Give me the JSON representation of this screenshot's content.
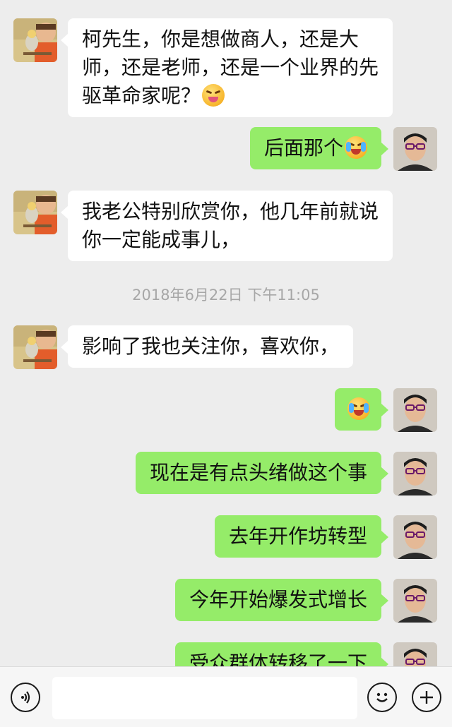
{
  "messages": [
    {
      "side": "in",
      "lines": [
        "柯先生，你是想做商人，还是大",
        "师，还是老师，还是一个业界的先",
        "驱革命家呢？"
      ],
      "emoji": "tongue-face"
    },
    {
      "side": "out",
      "lines": [
        "后面那个"
      ],
      "emoji": "laughing-tears-face"
    },
    {
      "side": "in",
      "lines": [
        "我老公特别欣赏你，他几年前就说",
        "你一定能成事儿，"
      ]
    },
    {
      "side": "in",
      "lines": [
        "影响了我也关注你，喜欢你，"
      ]
    },
    {
      "side": "out",
      "lines": [],
      "emoji": "laughing-tears-face"
    },
    {
      "side": "out",
      "lines": [
        "现在是有点头绪做这个事"
      ]
    },
    {
      "side": "out",
      "lines": [
        "去年开作坊转型"
      ]
    },
    {
      "side": "out",
      "lines": [
        "今年开始爆发式增长"
      ]
    },
    {
      "side": "out",
      "lines": [
        "受众群体转移了一下"
      ]
    }
  ],
  "timestamp": "2018年6月22日 下午11:05",
  "input_bar": {
    "voice_icon": "voice-icon",
    "emoji_icon": "smiley-icon",
    "plus_icon": "plus-icon",
    "value": ""
  },
  "colors": {
    "background": "#ededed",
    "outgoing_bubble": "#95ec69",
    "incoming_bubble": "#ffffff",
    "timestamp_text": "#a7a7a7"
  }
}
